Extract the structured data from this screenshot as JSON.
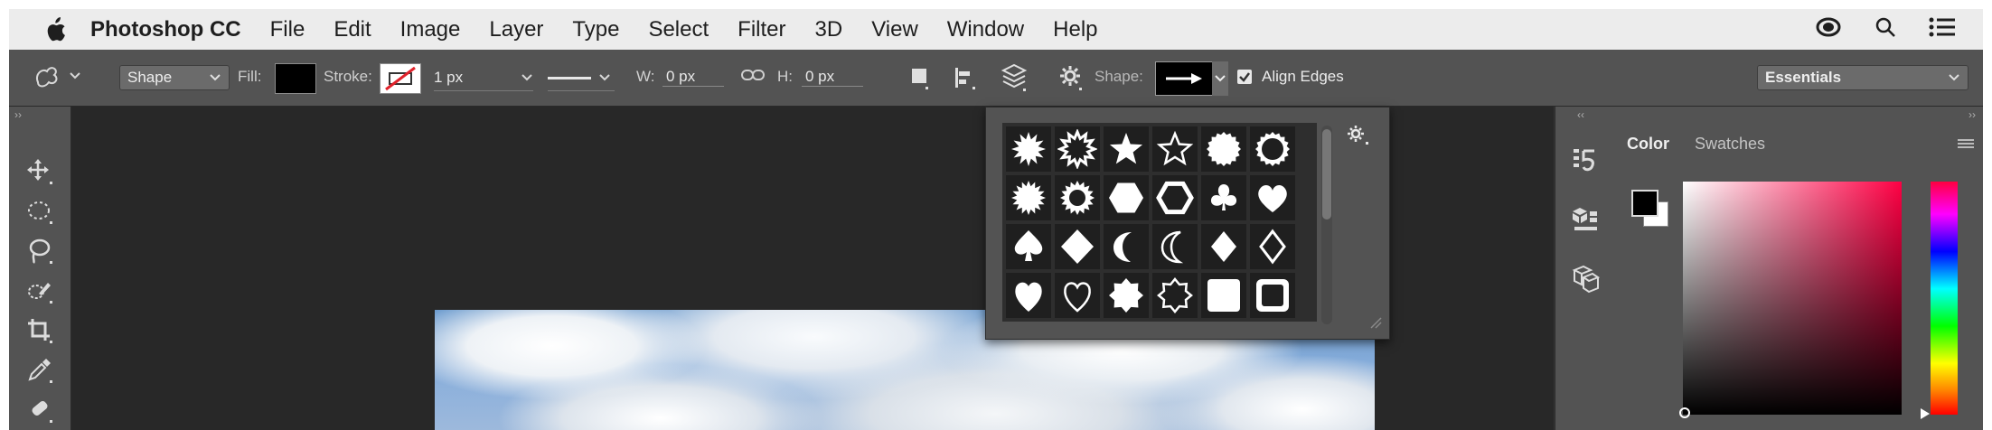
{
  "menubar": {
    "app_name": "Photoshop CC",
    "items": [
      "File",
      "Edit",
      "Image",
      "Layer",
      "Type",
      "Select",
      "Filter",
      "3D",
      "View",
      "Window",
      "Help"
    ]
  },
  "options_bar": {
    "mode": "Shape",
    "fill_label": "Fill:",
    "stroke_label": "Stroke:",
    "stroke_width": "1 px",
    "w_label": "W:",
    "w_value": "0 px",
    "h_label": "H:",
    "h_value": "0 px",
    "shape_label": "Shape:",
    "align_edges_label": "Align Edges",
    "align_edges_checked": true,
    "workspace": "Essentials"
  },
  "tools": [
    "move-tool",
    "elliptical-marquee-tool",
    "lasso-tool",
    "quick-selection-tool",
    "crop-tool",
    "eyedropper-tool",
    "healing-brush-tool"
  ],
  "shape_picker": {
    "shapes": [
      "starburst-8",
      "starburst-12",
      "star-5",
      "star-5-outline",
      "seal",
      "circle-frame",
      "sun",
      "gear-sun",
      "hexagon",
      "hexagon-outline",
      "club",
      "heart",
      "spade",
      "diamond",
      "moon",
      "moon-outline",
      "diamond-small",
      "diamond-outline",
      "heart-solid",
      "heart-outline",
      "star-8",
      "star-8-outline",
      "square-rounded",
      "square-frame"
    ]
  },
  "color_panel": {
    "tabs": [
      "Color",
      "Swatches"
    ],
    "active_tab": "Color",
    "foreground": "#000000",
    "background": "#ffffff"
  },
  "colors": {
    "ui_dark": "#535353",
    "canvas_bg": "#282828",
    "menubar_bg": "#ececec"
  }
}
